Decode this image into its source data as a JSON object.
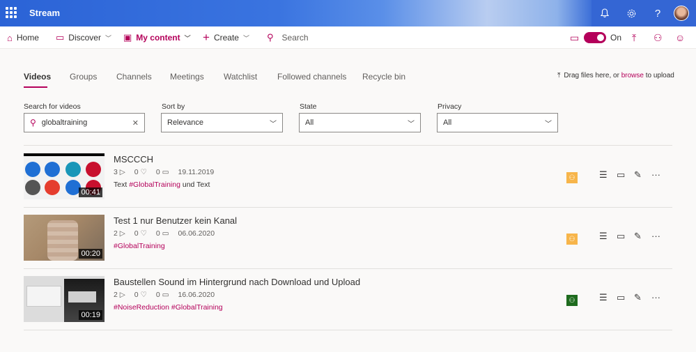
{
  "app": {
    "brand": "Stream"
  },
  "appbar_icons": [
    "bell-icon",
    "gear-icon",
    "help-icon"
  ],
  "nav": {
    "home": "Home",
    "discover": "Discover",
    "my_content": "My content",
    "create": "Create",
    "search_placeholder": "Search",
    "toggle_label": "On"
  },
  "tabs": [
    "Videos",
    "Groups",
    "Channels",
    "Meetings",
    "Watchlist",
    "Followed channels",
    "Recycle bin"
  ],
  "upload_hint": {
    "prefix": "Drag files here, or ",
    "link": "browse",
    "suffix": " to upload"
  },
  "filters": {
    "search_label": "Search for videos",
    "search_value": "globaltraining",
    "sort_label": "Sort by",
    "sort_value": "Relevance",
    "state_label": "State",
    "state_value": "All",
    "privacy_label": "Privacy",
    "privacy_value": "All"
  },
  "videos": [
    {
      "title": "MSCCCH",
      "views": "3",
      "likes": "0",
      "comments": "0",
      "date": "19.11.2019",
      "duration": "00:41",
      "desc_pre": "Text ",
      "desc_tag": "#GlobalTraining",
      "desc_post": " und Text",
      "privacy_color": "#f7b54a"
    },
    {
      "title": "Test 1 nur Benutzer kein Kanal",
      "views": "2",
      "likes": "0",
      "comments": "0",
      "date": "06.06.2020",
      "duration": "00:20",
      "desc_pre": "",
      "desc_tag": "#GlobalTraining",
      "desc_post": "",
      "privacy_color": "#f7b54a"
    },
    {
      "title": "Baustellen Sound im Hintergrund nach Download und Upload",
      "views": "2",
      "likes": "0",
      "comments": "0",
      "date": "16.06.2020",
      "duration": "00:19",
      "desc_pre": "",
      "desc_tag": "#NoiseReduction #GlobalTraining",
      "desc_post": "",
      "privacy_color": "#1e6b1e"
    }
  ]
}
